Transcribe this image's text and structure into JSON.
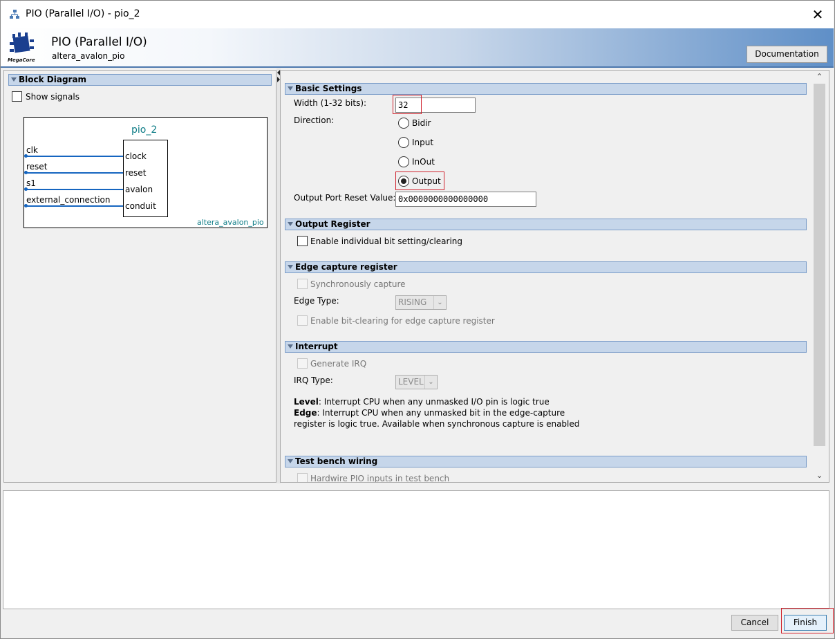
{
  "window": {
    "title": "PIO (Parallel I/O) - pio_2",
    "close_glyph": "✕"
  },
  "header": {
    "title": "PIO (Parallel I/O)",
    "subtitle": "altera_avalon_pio",
    "logo_text": "MegaCore",
    "documentation_label": "Documentation"
  },
  "left_panel": {
    "section_title": "Block Diagram",
    "show_signals_label": "Show signals",
    "show_signals_checked": false,
    "diagram": {
      "instance_name": "pio_2",
      "component_name": "altera_avalon_pio",
      "signals": [
        {
          "outer": "clk",
          "inner": "clock"
        },
        {
          "outer": "reset",
          "inner": "reset"
        },
        {
          "outer": "s1",
          "inner": "avalon"
        },
        {
          "outer": "external_connection",
          "inner": "conduit"
        }
      ]
    }
  },
  "basic_settings": {
    "title": "Basic Settings",
    "width_label": "Width (1-32 bits):",
    "width_value": "32",
    "direction_label": "Direction:",
    "direction_options": [
      "Bidir",
      "Input",
      "InOut",
      "Output"
    ],
    "direction_selected": "Output",
    "reset_value_label": "Output Port Reset Value:",
    "reset_value": "0x0000000000000000"
  },
  "output_register": {
    "title": "Output Register",
    "bit_setting_label": "Enable individual bit setting/clearing"
  },
  "edge_capture": {
    "title": "Edge capture register",
    "sync_capture_label": "Synchronously capture",
    "edge_type_label": "Edge Type:",
    "edge_type_value": "RISING",
    "bit_clearing_label": "Enable bit-clearing for edge capture register"
  },
  "interrupt": {
    "title": "Interrupt",
    "generate_irq_label": "Generate IRQ",
    "irq_type_label": "IRQ Type:",
    "irq_type_value": "LEVEL",
    "level_term": "Level",
    "level_desc": ": Interrupt CPU when any unmasked I/O pin is logic true",
    "edge_term": "Edge",
    "edge_desc_1": ": Interrupt CPU when any unmasked bit in the edge-capture",
    "edge_desc_2": "register is logic true. Available when synchronous capture is enabled"
  },
  "test_bench": {
    "title": "Test bench wiring",
    "hardwire_label": "Hardwire PIO inputs in test bench"
  },
  "footer": {
    "cancel_label": "Cancel",
    "finish_label": "Finish"
  },
  "colors": {
    "accent_blue": "#4c77ad",
    "section_bar": "#c6d6ea",
    "highlight_red": "#d0202b",
    "diagram_teal": "#0e7c86"
  }
}
